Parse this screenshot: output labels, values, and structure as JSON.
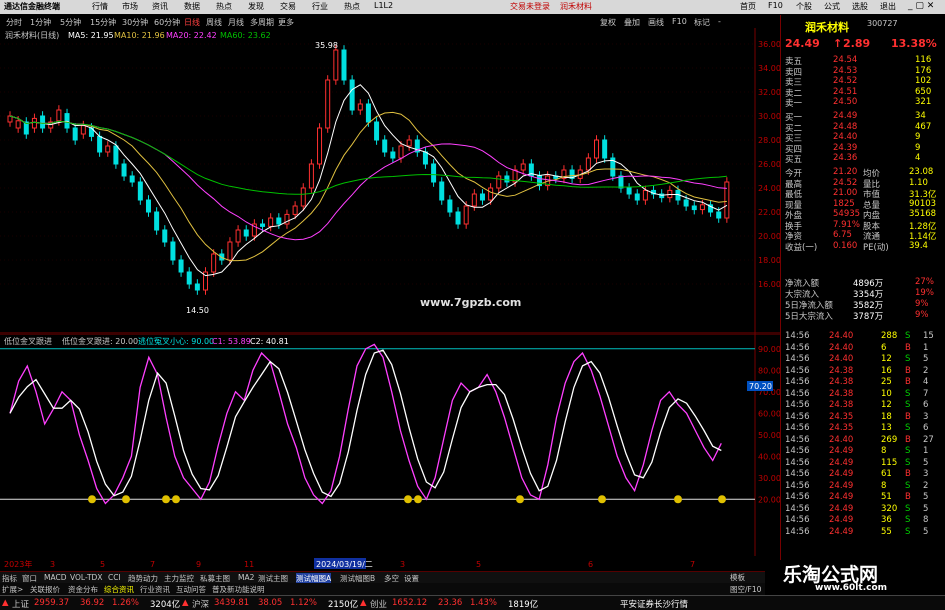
{
  "menu": {
    "app_title": "通达信金融终端",
    "items": [
      "行情",
      "市场",
      "资讯",
      "数据",
      "热点",
      "发现",
      "交易",
      "行业",
      "热点",
      "L1L2"
    ],
    "center": [
      "交易未登录",
      "润禾材料"
    ],
    "right": [
      "首页",
      "F10",
      "个股",
      "公式",
      "选股",
      "退出"
    ]
  },
  "periods": [
    {
      "label": "分时",
      "active": false
    },
    {
      "label": "1分钟",
      "active": false
    },
    {
      "label": "5分钟",
      "active": false
    },
    {
      "label": "15分钟",
      "active": false
    },
    {
      "label": "30分钟",
      "active": false
    },
    {
      "label": "60分钟",
      "active": false
    },
    {
      "label": "日线",
      "active": true
    },
    {
      "label": "周线",
      "active": false
    },
    {
      "label": "月线",
      "active": false
    },
    {
      "label": "多周期",
      "active": false
    },
    {
      "label": "更多",
      "active": false
    }
  ],
  "toolbar_right": [
    "复权",
    "叠加",
    "画线",
    "F10",
    "标记",
    "-"
  ],
  "stock": {
    "name": "润禾材料",
    "code": "300727",
    "price": "24.49",
    "change": "2.89",
    "pct": "13.38%"
  },
  "ma_legend": {
    "title": "润禾材料(日线)",
    "ma5": "MA5: 21.95",
    "ma10": "MA10: 21.96",
    "ma20": "MA20: 22.42",
    "ma60": "MA60: 23.62"
  },
  "main_axis": [
    "36.00",
    "34.00",
    "32.00",
    "30.00",
    "28.00",
    "26.00",
    "24.00",
    "22.00",
    "20.00",
    "18.00",
    "16.00"
  ],
  "annotations": {
    "high": "35.98",
    "low": "14.50",
    "watermark": "www.7gpzb.com"
  },
  "osc_legend": {
    "name": "低位金叉跟进",
    "desc": "低位金叉跟进: 20.00",
    "l2": "逃位冤叉小心: 90.00",
    "c1": "C1: 53.89",
    "c2": "C2: 40.81"
  },
  "osc_axis": [
    "90.00",
    "80.00",
    "70.00",
    "60.00",
    "50.00",
    "40.00",
    "30.00",
    "20.00"
  ],
  "osc_cursor": "70.20",
  "timeline": {
    "year": "2023年",
    "marks": [
      "3",
      "5",
      "7",
      "9",
      "11",
      "2",
      "3",
      "5",
      "6",
      "7"
    ],
    "date_cursor": "2024/03/19/二"
  },
  "orderbook": {
    "asks": [
      {
        "label": "卖五",
        "price": "24.54",
        "vol": "116"
      },
      {
        "label": "卖四",
        "price": "24.53",
        "vol": "176"
      },
      {
        "label": "卖三",
        "price": "24.52",
        "vol": "102"
      },
      {
        "label": "卖二",
        "price": "24.51",
        "vol": "650"
      },
      {
        "label": "卖一",
        "price": "24.50",
        "vol": "321"
      }
    ],
    "bids": [
      {
        "label": "买一",
        "price": "24.49",
        "vol": "34"
      },
      {
        "label": "买二",
        "price": "24.48",
        "vol": "467"
      },
      {
        "label": "买三",
        "price": "24.40",
        "vol": "9"
      },
      {
        "label": "买四",
        "price": "24.39",
        "vol": "9"
      },
      {
        "label": "买五",
        "price": "24.36",
        "vol": "4"
      }
    ]
  },
  "stats": [
    {
      "l": "今开",
      "v": "21.20",
      "l2": "均价",
      "v2": "23.08"
    },
    {
      "l": "最高",
      "v": "24.52",
      "l2": "量比",
      "v2": "1.10"
    },
    {
      "l": "最低",
      "v": "21.00",
      "l2": "市值",
      "v2": "31.3亿"
    },
    {
      "l": "现量",
      "v": "1825",
      "l2": "总量",
      "v2": "90103"
    },
    {
      "l": "外盘",
      "v": "54935",
      "l2": "内盘",
      "v2": "35168"
    },
    {
      "l": "换手",
      "v": "7.91%",
      "l2": "股本",
      "v2": "1.28亿"
    },
    {
      "l": "净资",
      "v": "6.75",
      "l2": "流通",
      "v2": "1.14亿"
    },
    {
      "l": "收益(一)",
      "v": "0.160",
      "l2": "PE(动)",
      "v2": "39.4"
    }
  ],
  "flows": [
    {
      "l": "净流入额",
      "v": "4896万",
      "p": "27%"
    },
    {
      "l": "大宗流入",
      "v": "3354万",
      "p": "19%"
    },
    {
      "l": "5日净流入额",
      "v": "3582万",
      "p": "9%"
    },
    {
      "l": "5日大宗流入",
      "v": "3787万",
      "p": "9%"
    }
  ],
  "ticks": [
    {
      "t": "14:56",
      "p": "24.40",
      "v": "288",
      "s": "S",
      "n": "15"
    },
    {
      "t": "14:56",
      "p": "24.40",
      "v": "6",
      "s": "B",
      "n": "1"
    },
    {
      "t": "14:56",
      "p": "24.40",
      "v": "12",
      "s": "S",
      "n": "5"
    },
    {
      "t": "14:56",
      "p": "24.38",
      "v": "16",
      "s": "B",
      "n": "2"
    },
    {
      "t": "14:56",
      "p": "24.38",
      "v": "25",
      "s": "B",
      "n": "4"
    },
    {
      "t": "14:56",
      "p": "24.38",
      "v": "10",
      "s": "S",
      "n": "7"
    },
    {
      "t": "14:56",
      "p": "24.38",
      "v": "12",
      "s": "S",
      "n": "6"
    },
    {
      "t": "14:56",
      "p": "24.35",
      "v": "18",
      "s": "B",
      "n": "3"
    },
    {
      "t": "14:56",
      "p": "24.35",
      "v": "13",
      "s": "S",
      "n": "6"
    },
    {
      "t": "14:56",
      "p": "24.40",
      "v": "269",
      "s": "B",
      "n": "27"
    },
    {
      "t": "14:56",
      "p": "24.49",
      "v": "8",
      "s": "S",
      "n": "1"
    },
    {
      "t": "14:56",
      "p": "24.49",
      "v": "115",
      "s": "S",
      "n": "5"
    },
    {
      "t": "14:56",
      "p": "24.49",
      "v": "61",
      "s": "B",
      "n": "3"
    },
    {
      "t": "14:56",
      "p": "24.49",
      "v": "8",
      "s": "S",
      "n": "2"
    },
    {
      "t": "14:56",
      "p": "24.49",
      "v": "51",
      "s": "B",
      "n": "5"
    },
    {
      "t": "14:56",
      "p": "24.49",
      "v": "320",
      "s": "S",
      "n": "5"
    },
    {
      "t": "14:56",
      "p": "24.49",
      "v": "36",
      "s": "S",
      "n": "8"
    },
    {
      "t": "14:56",
      "p": "24.49",
      "v": "55",
      "s": "S",
      "n": "5"
    }
  ],
  "tabs": [
    "指标",
    "窗口",
    "MACD",
    "VOL-TDX",
    "CCI",
    "趋势动力",
    "主力监控",
    "私募主图",
    "MA2",
    "测试主图",
    "测试幅图A",
    "测试幅图B",
    "多空",
    "设置"
  ],
  "subtabs": [
    "扩展>",
    "关联报价",
    "资金分布",
    "综合资讯",
    "行业资讯",
    "互动问答",
    "普及新功能说明"
  ],
  "rightfoot": [
    "模板",
    "图空/F10"
  ],
  "status": [
    {
      "n": "上证",
      "v": "2959.37",
      "c": "36.92",
      "p": "1.26%",
      "a": "3204亿"
    },
    {
      "n": "沪深",
      "v": "3439.81",
      "c": "38.05",
      "p": "1.12%",
      "a": "2150亿"
    },
    {
      "n": "创业",
      "v": "1652.12",
      "c": "23.36",
      "p": "1.43%",
      "a": "1819亿"
    }
  ],
  "status_right": "平安证券长沙行情",
  "brand": {
    "cn": "乐淘公式网",
    "url": "www.60lt.com"
  },
  "colors": {
    "up": "#ff3030",
    "down": "#00e0e0",
    "ma5": "#ffffff",
    "ma10": "#e0c040",
    "ma20": "#ff40ff",
    "ma60": "#00c000",
    "k": "#ff40ff",
    "d": "#ffffff"
  }
}
